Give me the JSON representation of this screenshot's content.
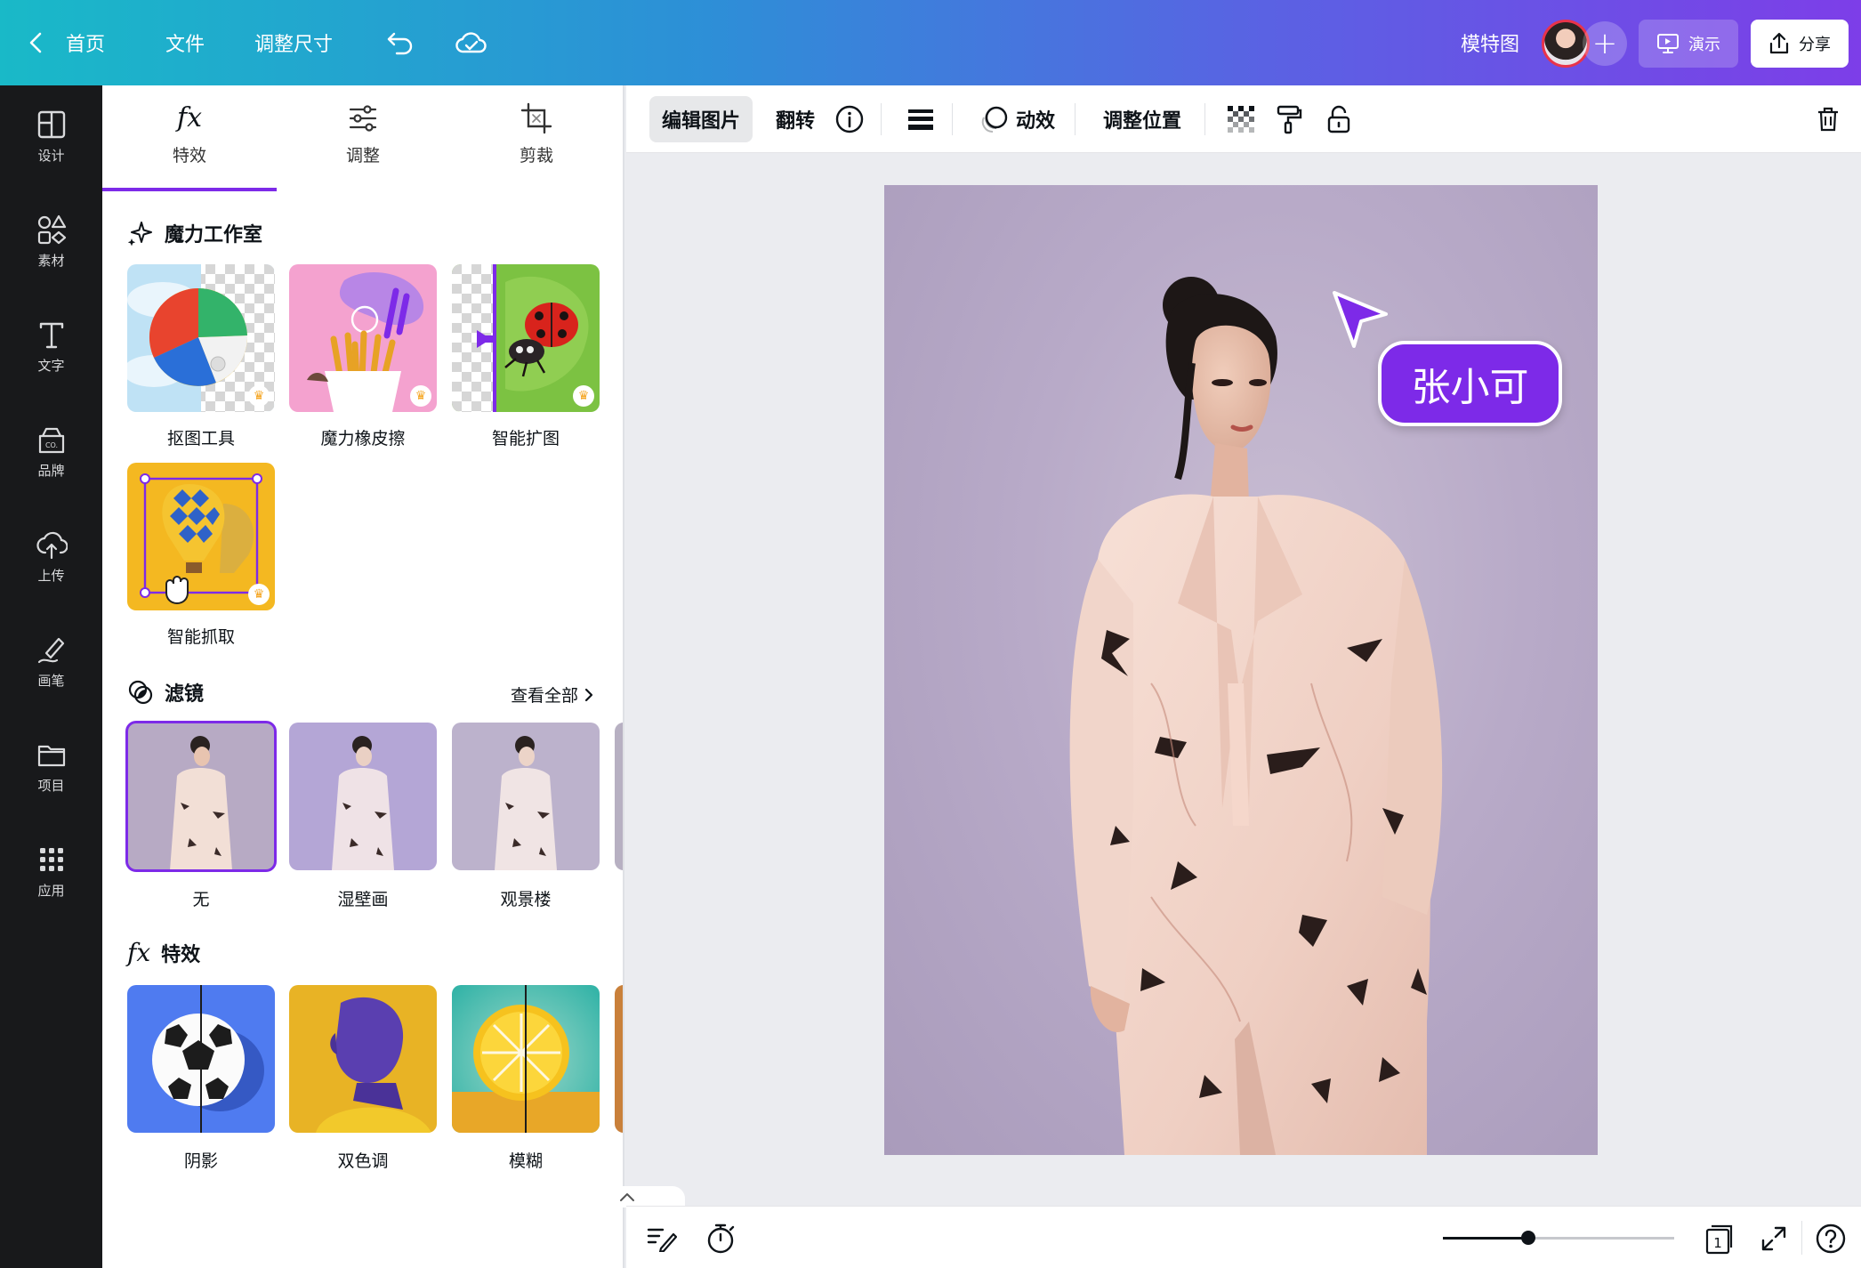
{
  "topbar": {
    "home": "首页",
    "file": "文件",
    "resize": "调整尺寸",
    "doc_title": "模特图",
    "present": "演示",
    "share": "分享"
  },
  "rail": {
    "items": [
      {
        "label": "设计",
        "icon": "layout-icon"
      },
      {
        "label": "素材",
        "icon": "elements-icon"
      },
      {
        "label": "文字",
        "icon": "text-icon"
      },
      {
        "label": "品牌",
        "icon": "brand-icon"
      },
      {
        "label": "上传",
        "icon": "upload-icon"
      },
      {
        "label": "画笔",
        "icon": "draw-icon"
      },
      {
        "label": "项目",
        "icon": "folder-icon"
      },
      {
        "label": "应用",
        "icon": "apps-icon"
      }
    ]
  },
  "panel": {
    "tabs": [
      {
        "label": "特效",
        "icon": "fx-icon",
        "active": true
      },
      {
        "label": "调整",
        "icon": "sliders-icon",
        "active": false
      },
      {
        "label": "剪裁",
        "icon": "crop-icon",
        "active": false
      }
    ],
    "magic_studio": {
      "title": "魔力工作室",
      "tools": [
        "抠图工具",
        "魔力橡皮擦",
        "智能扩图",
        "智能抓取"
      ]
    },
    "filters": {
      "title": "滤镜",
      "see_all": "查看全部",
      "items": [
        "无",
        "湿壁画",
        "观景楼"
      ],
      "selected": "无"
    },
    "effects": {
      "title": "特效",
      "items": [
        "阴影",
        "双色调",
        "模糊"
      ]
    }
  },
  "context_toolbar": {
    "edit_image": "编辑图片",
    "flip": "翻转",
    "animate": "动效",
    "position": "调整位置"
  },
  "canvas": {
    "collaborator_tag": "张小可"
  },
  "bottombar": {
    "zoom_level": 0.37,
    "page_number": "1"
  },
  "colors": {
    "accent": "#7d2ae8",
    "rail_bg": "#18191b",
    "gradient_start": "#19b9c8",
    "gradient_end": "#7d3ee8"
  }
}
